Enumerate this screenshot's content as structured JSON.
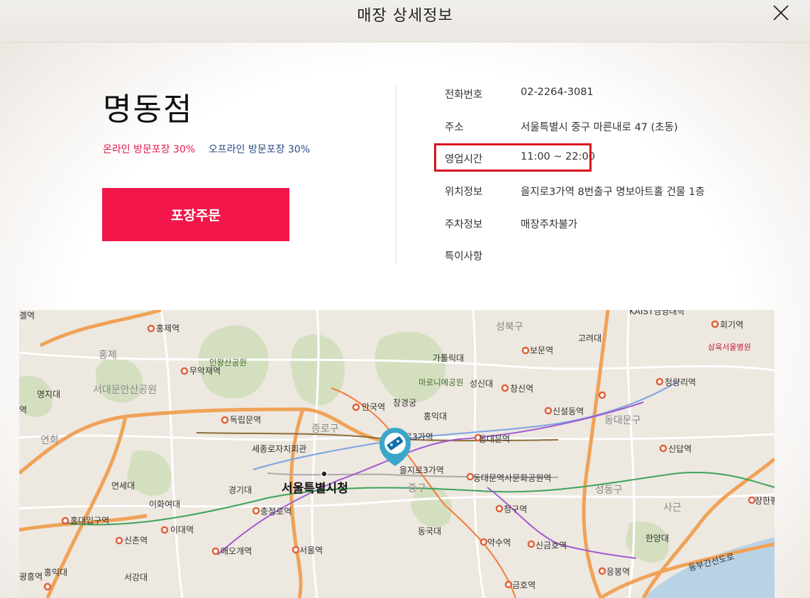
{
  "header": {
    "title": "매장 상세정보"
  },
  "store": {
    "name": "명동점",
    "promo_online": "온라인 방문포장 30%",
    "promo_offline": "오프라인 방문포장 30%",
    "order_button": "포장주문"
  },
  "info": [
    {
      "label": "전화번호",
      "value": "02-2264-3081"
    },
    {
      "label": "주소",
      "value": "서울특별시 중구 마른내로 47 (초동)"
    },
    {
      "label": "영업시간",
      "value": "11:00 ~ 22:00"
    },
    {
      "label": "위치정보",
      "value": "을지로3가역 8번출구 명보아트홀 건물 1층"
    },
    {
      "label": "주차정보",
      "value": "매장주차불가"
    },
    {
      "label": "특이사항",
      "value": ""
    }
  ],
  "map": {
    "labels": {
      "hongje_station": "홍제역",
      "hongje": "홍제",
      "inwangsan": "인왕산공원",
      "muakjae": "무악재역",
      "seodaemun_ansan": "서대문안산공원",
      "myeongji": "명지대",
      "yeok_left": "역",
      "dongnimmun": "독립문역",
      "yeonhui": "연희",
      "yeonse": "연세대",
      "ewha": "이화여대",
      "hongdae_ipgu": "홍대입구역",
      "sinchon": "신촌역",
      "idae": "이대역",
      "gyeonggidae": "경기대",
      "chungjeongno": "충정로역",
      "aeogae": "애오개역",
      "hongikdae_left": "홍익대",
      "seogangdae": "서강대",
      "gwangheung": "광흥역",
      "seoul_station": "서울역",
      "seoul_city_hall": "서울특별시청",
      "sejong": "세종로자치회관",
      "jongno_gu": "종로구",
      "jung_gu": "중구",
      "anguk": "안국역",
      "changgyeong": "창경궁",
      "hongikdae_center": "홍익대",
      "jongno3ga": "종로3가역",
      "euljiro3ga": "을지로3가역",
      "dongdaemun": "동대문역",
      "ddp": "동대문역사문화공원역",
      "dongguk": "동국대",
      "cheonggu": "청구역",
      "yaksu": "약수역",
      "sindang_hall": "신금호역",
      "geumho": "금호역",
      "seongbuk_gu": "성북구",
      "catholic": "가톨릭대",
      "maronie": "마로니에공원",
      "seongsindae": "성신대",
      "bomun": "보문역",
      "changsin": "창신역",
      "sinseoldong": "신설동역",
      "dongdaemun_gu": "동대문구",
      "koryo": "고려대",
      "hoegi": "회기역",
      "samyuk": "삼육서울병원",
      "cheongnyangni": "청량리역",
      "sindap": "신답역",
      "seongdong_gu": "성동구",
      "sageun": "사근",
      "hanyangdae": "한양대",
      "janghan": "장한평",
      "eungbong": "응봉역",
      "kaist": "KAIST경영대학",
      "dongbu": "동부간선도로",
      "gayeok": "곌역"
    }
  }
}
